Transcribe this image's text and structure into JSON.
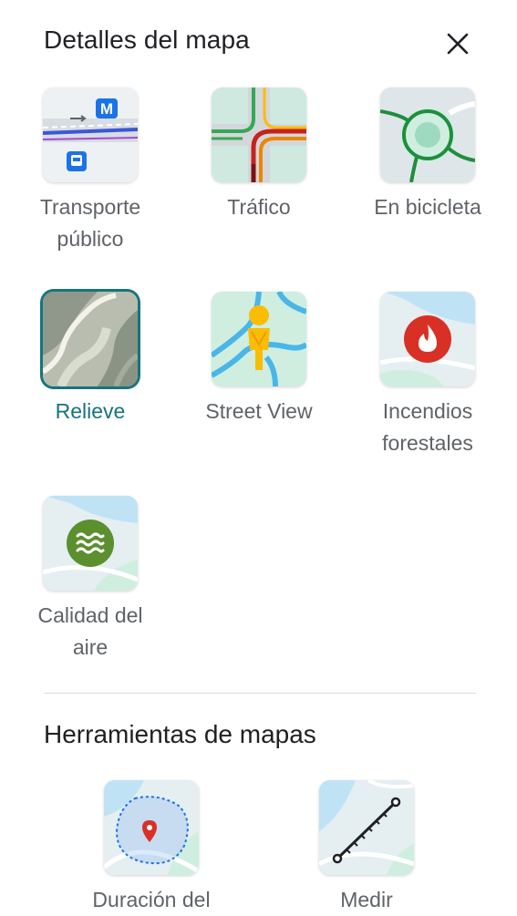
{
  "panel": {
    "title": "Detalles del mapa",
    "close_icon": "close-icon"
  },
  "map_details": [
    {
      "id": "transit",
      "label": "Transporte público",
      "icon": "transit-thumbnail",
      "selected": false
    },
    {
      "id": "traffic",
      "label": "Tráfico",
      "icon": "traffic-thumbnail",
      "selected": false
    },
    {
      "id": "bicycling",
      "label": "En bicicleta",
      "icon": "bicycle-thumbnail",
      "selected": false
    },
    {
      "id": "terrain",
      "label": "Relieve",
      "icon": "terrain-thumbnail",
      "selected": true
    },
    {
      "id": "streetview",
      "label": "Street View",
      "icon": "streetview-thumbnail",
      "selected": false
    },
    {
      "id": "wildfires",
      "label": "Incendios forestales",
      "icon": "wildfire-thumbnail",
      "selected": false
    },
    {
      "id": "airquality",
      "label": "Calidad del aire",
      "icon": "air-quality-thumbnail",
      "selected": false
    }
  ],
  "tools": {
    "title": "Herramientas de mapas",
    "items": [
      {
        "id": "traveltime",
        "label": "Duración del",
        "icon": "travel-time-thumbnail"
      },
      {
        "id": "measure",
        "label": "Medir",
        "icon": "measure-thumbnail"
      }
    ]
  },
  "colors": {
    "accent": "#17747c",
    "label_text": "#5f6368",
    "title_text": "#202124",
    "divider": "#dadce0"
  }
}
